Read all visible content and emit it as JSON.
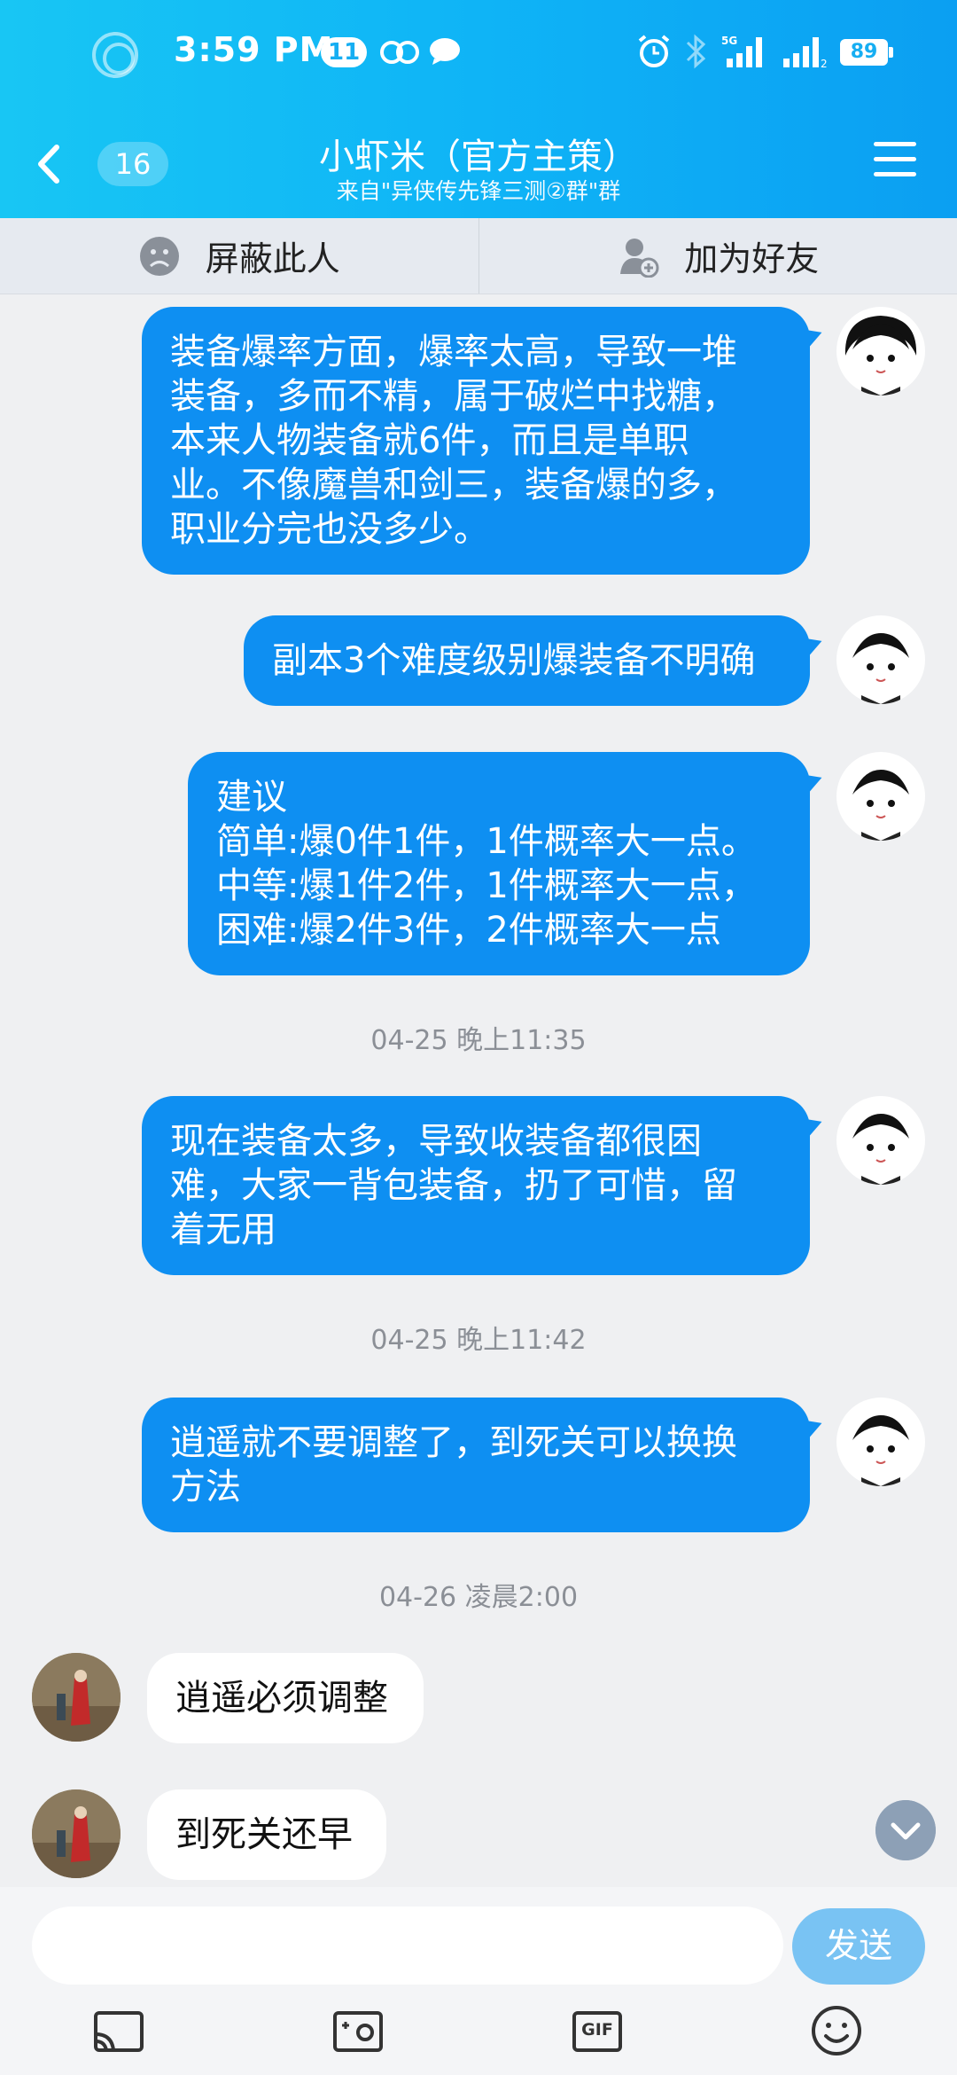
{
  "status_bar": {
    "time": "3:59 PM",
    "notification_count": "11",
    "network": "5G",
    "battery": "89"
  },
  "header": {
    "unread_count": "16",
    "title": "小虾米（官方主策）",
    "subtitle": "来自\"异侠传先锋三测②群\"群"
  },
  "actions": {
    "block_label": "屏蔽此人",
    "add_friend_label": "加为好友"
  },
  "messages": [
    {
      "side": "out",
      "text": "装备爆率方面，爆率太高，导致一堆\n装备，多而不精，属于破烂中找糖，\n本来人物装备就6件，而且是单职\n业。不像魔兽和剑三，装备爆的多，\n职业分完也没多少。"
    },
    {
      "side": "out",
      "text": "副本3个难度级别爆装备不明确"
    },
    {
      "side": "out",
      "text": "建议\n简单:爆0件1件，1件概率大一点。\n中等:爆1件2件，1件概率大一点，\n困难:爆2件3件，2件概率大一点"
    },
    {
      "side": "out",
      "text": "现在装备太多，导致收装备都很困\n难，大家一背包装备，扔了可惜，留\n着无用"
    },
    {
      "side": "out",
      "text": "逍遥就不要调整了，到死关可以换换\n方法"
    },
    {
      "side": "in",
      "text": "逍遥必须调整"
    },
    {
      "side": "in",
      "text": "到死关还早"
    }
  ],
  "timestamps": [
    "04-25 晚上11:35",
    "04-25 晚上11:42",
    "04-26 凌晨2:00"
  ],
  "input": {
    "value": "",
    "send_label": "发送"
  },
  "toolbar": {
    "gif_label": "GIF"
  },
  "colors": {
    "accent": "#0e8ff2",
    "header": "#12b3f5",
    "send": "#79c3f3"
  }
}
